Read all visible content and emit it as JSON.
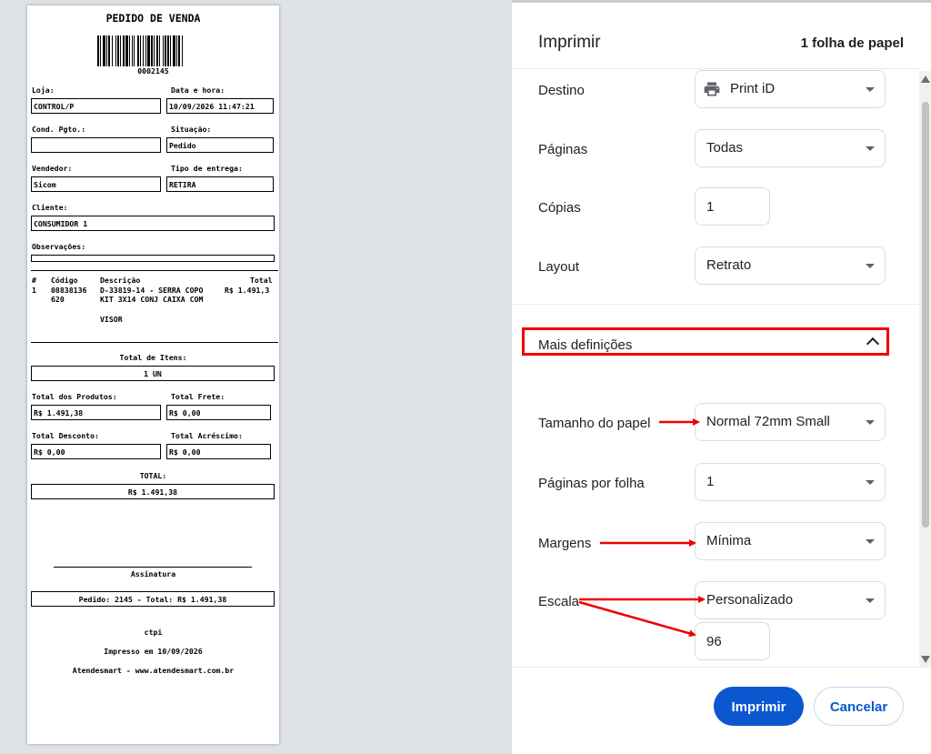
{
  "receipt": {
    "title": "PEDIDO DE VENDA",
    "order_number": "0002145",
    "loja_label": "Loja:",
    "loja_value": "CONTROL/P",
    "data_hora_label": "Data e hora:",
    "data_hora_value": "10/09/2026 11:47:21",
    "cond_pgto_label": "Cond. Pgto.:",
    "cond_pgto_value": "",
    "situacao_label": "Situação:",
    "situacao_value": "Pedido",
    "vendedor_label": "Vendedor:",
    "vendedor_value": "Sicom",
    "tipo_entrega_label": "Tipo de entrega:",
    "tipo_entrega_value": "RETIRA",
    "cliente_label": "Cliente:",
    "cliente_value": "CONSUMIDOR 1",
    "observacoes_label": "Observações:",
    "items_header": {
      "num": "#",
      "codigo": "Código",
      "descricao": "Descrição",
      "total": "Total"
    },
    "item": {
      "num": "1",
      "codigo_1": "08838136",
      "codigo_2": "620",
      "descricao_1": "D-33819-14 - SERRA COPO",
      "descricao_2": "KIT 3X14 CONJ CAIXA COM",
      "descricao_3": "VISOR",
      "total": "R$ 1.491,3"
    },
    "total_itens_label": "Total de Itens:",
    "total_itens_value": "1 UN",
    "total_produtos_label": "Total dos Produtos:",
    "total_produtos_value": "R$ 1.491,38",
    "total_frete_label": "Total Frete:",
    "total_frete_value": "R$ 0,00",
    "total_desconto_label": "Total Desconto:",
    "total_desconto_value": "R$ 0,00",
    "total_acrescimo_label": "Total Acréscimo:",
    "total_acrescimo_value": "R$ 0,00",
    "total_label": "TOTAL:",
    "total_value": "R$ 1.491,38",
    "assinatura": "Assinatura",
    "pedido_summary": "Pedido: 2145 - Total: R$ 1.491,38",
    "footer_user": "ctpi",
    "footer_printed": "Impresso em 10/09/2026",
    "footer_site": "Atendesmart - www.atendesmart.com.br"
  },
  "print_dialog": {
    "title": "Imprimir",
    "sheet_count": "1 folha de papel",
    "destino_label": "Destino",
    "destino_value": "Print iD",
    "paginas_label": "Páginas",
    "paginas_value": "Todas",
    "copias_label": "Cópias",
    "copias_value": "1",
    "layout_label": "Layout",
    "layout_value": "Retrato",
    "mais_definicoes": "Mais definições",
    "tamanho_label": "Tamanho do papel",
    "tamanho_value": "Normal 72mm Small",
    "paginas_por_folha_label": "Páginas por folha",
    "paginas_por_folha_value": "1",
    "margens_label": "Margens",
    "margens_value": "Mínima",
    "escala_label": "Escala",
    "escala_value": "Personalizado",
    "escala_custom_value": "96",
    "print_button": "Imprimir",
    "cancel_button": "Cancelar"
  },
  "colors": {
    "accent": "#0b57d0",
    "highlight_red": "#e00000",
    "preview_bg": "#dee1e6"
  }
}
